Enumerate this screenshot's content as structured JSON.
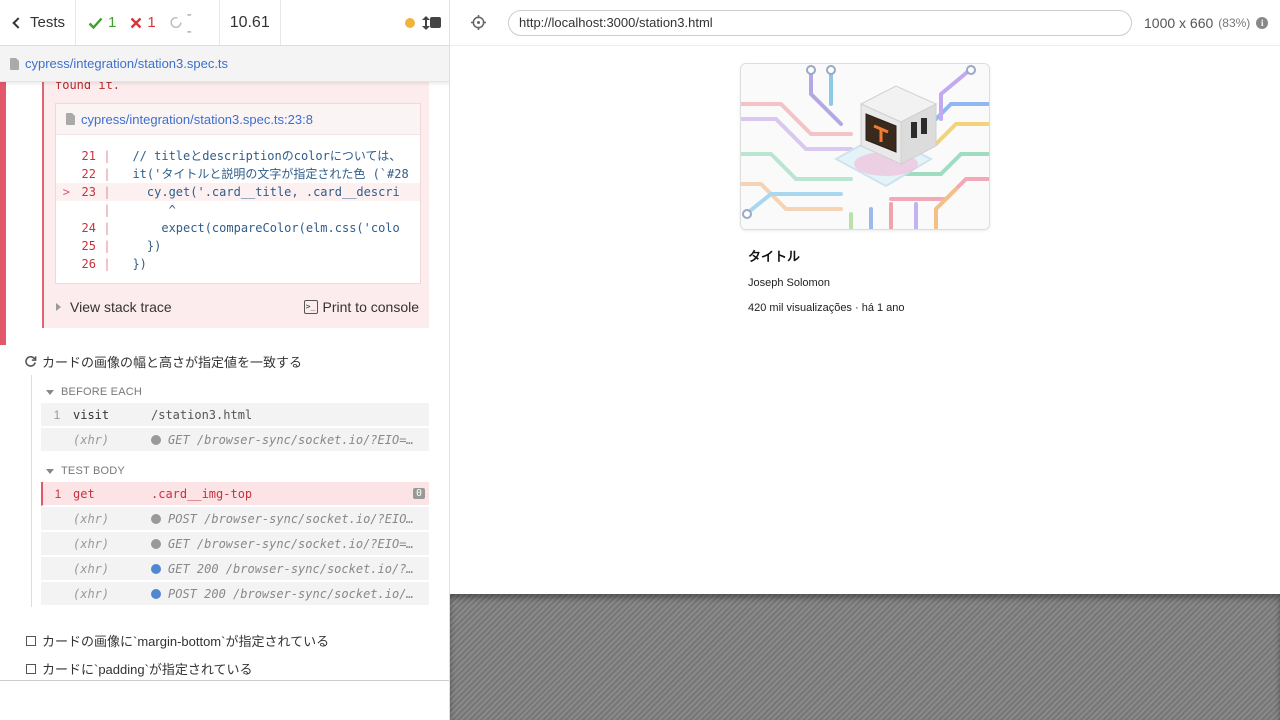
{
  "stats": {
    "tests_label": "Tests",
    "passed": "1",
    "failed": "1",
    "pending": "--",
    "duration": "10.61"
  },
  "spec": {
    "path": "cypress/integration/station3.spec.ts"
  },
  "error": {
    "message_tail": "found it.",
    "frame_file": "cypress/integration/station3.spec.ts:23:8",
    "code_lines": [
      {
        "arrow": "",
        "num": "21",
        "text": "  // titleとdescriptionのcolorについては、",
        "highlight": false
      },
      {
        "arrow": "",
        "num": "22",
        "text": "  it('タイトルと説明の文字が指定された色 (`#28",
        "highlight": false
      },
      {
        "arrow": ">",
        "num": "23",
        "text": "    cy.get('.card__title, .card__descri",
        "highlight": true
      },
      {
        "arrow": "",
        "num": "",
        "text": "       ^",
        "highlight": false
      },
      {
        "arrow": "",
        "num": "24",
        "text": "      expect(compareColor(elm.css('colo",
        "highlight": false
      },
      {
        "arrow": "",
        "num": "25",
        "text": "    })",
        "highlight": false
      },
      {
        "arrow": "",
        "num": "26",
        "text": "  })",
        "highlight": false
      }
    ],
    "stack_trace_label": "View stack trace",
    "print_console_label": "Print to console"
  },
  "running_test": {
    "title": "カードの画像の幅と高さが指定値を一致する",
    "before_each_label": "BEFORE EACH",
    "test_body_label": "TEST BODY",
    "before_each": [
      {
        "num": "1",
        "name": "visit",
        "message": "/station3.html",
        "type": "cmd"
      },
      {
        "num": "",
        "name": "(xhr)",
        "message": "GET /browser-sync/socket.io/?EIO=…",
        "type": "xhr",
        "dot": "gray"
      }
    ],
    "test_body": [
      {
        "num": "1",
        "name": "get",
        "message": ".card__img-top",
        "type": "error",
        "badge": "0"
      },
      {
        "num": "",
        "name": "(xhr)",
        "message": "POST /browser-sync/socket.io/?EIO…",
        "type": "xhr",
        "dot": "gray"
      },
      {
        "num": "",
        "name": "(xhr)",
        "message": "GET /browser-sync/socket.io/?EIO=…",
        "type": "xhr",
        "dot": "gray"
      },
      {
        "num": "",
        "name": "(xhr)",
        "message": "GET 200 /browser-sync/socket.io/?…",
        "type": "xhr",
        "dot": "blue"
      },
      {
        "num": "",
        "name": "(xhr)",
        "message": "POST 200 /browser-sync/socket.io/…",
        "type": "xhr",
        "dot": "blue"
      }
    ]
  },
  "pending_tests": [
    "カードの画像に`margin-bottom`が指定されている",
    "カードに`padding`が指定されている"
  ],
  "aut": {
    "url": "http://localhost:3000/station3.html",
    "viewport": "1000 x 660",
    "scale": "(83%)"
  },
  "card": {
    "title": "タイトル",
    "author": "Joseph Solomon",
    "views": "420 mil visualizações · há 1 ano"
  },
  "colors": {
    "fail": "#e2586a",
    "pass": "#40a02b",
    "link": "#3b6fd0",
    "running": "#f0b43c"
  }
}
